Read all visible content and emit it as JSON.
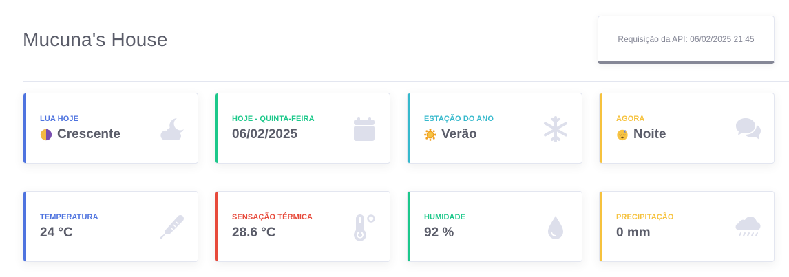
{
  "header": {
    "title": "Mucuna's House",
    "api_request": "Requisição da API: 06/02/2025 21:45"
  },
  "cards": [
    {
      "label": "LUA HOJE",
      "value": "Crescente",
      "emoji": "waxing-moon-emoji",
      "icon": "cloud-moon-icon",
      "color": "#4e73df"
    },
    {
      "label": "HOJE - QUINTA-FEIRA",
      "value": "06/02/2025",
      "icon": "calendar-icon",
      "color": "#1cc88a"
    },
    {
      "label": "ESTAÇÃO DO ANO",
      "value": "Verão",
      "emoji": "sun-emoji",
      "icon": "snowflake-icon",
      "color": "#36b9cc"
    },
    {
      "label": "AGORA",
      "value": "Noite",
      "emoji": "sleeping-face-emoji",
      "icon": "comments-icon",
      "color": "#f6c23e"
    },
    {
      "label": "TEMPERATURA",
      "value": "24 °C",
      "icon": "thermometer-icon",
      "color": "#4e73df"
    },
    {
      "label": "SENSAÇÃO TÉRMICA",
      "value": "28.6 °C",
      "icon": "temperature-degree-icon",
      "color": "#e74a3b"
    },
    {
      "label": "HUMIDADE",
      "value": "92 %",
      "icon": "droplet-icon",
      "color": "#1cc88a"
    },
    {
      "label": "PRECIPITAÇÃO",
      "value": "0 mm",
      "icon": "cloud-rain-icon",
      "color": "#f6c23e"
    }
  ]
}
